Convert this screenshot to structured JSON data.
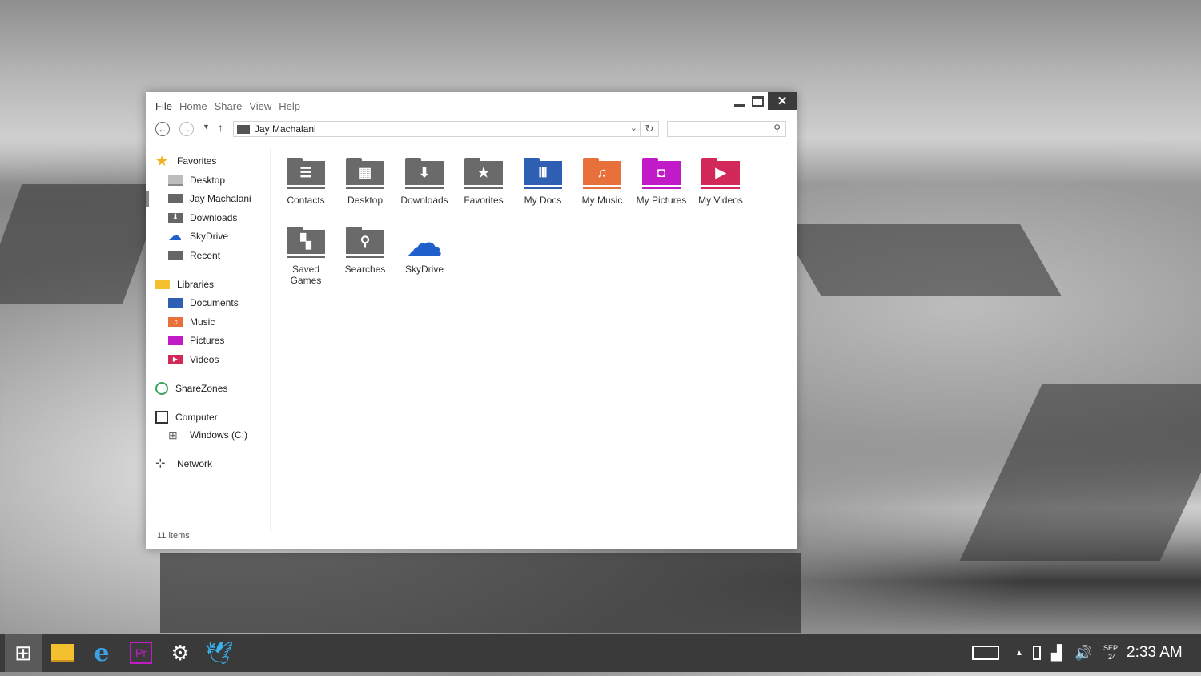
{
  "window": {
    "menu": [
      "File",
      "Home",
      "Share",
      "View",
      "Help"
    ],
    "close_label": "✕",
    "address": "Jay Machalani",
    "status": "11 items"
  },
  "sidebar": {
    "favorites": "Favorites",
    "fav_items": [
      "Desktop",
      "Jay Machalani",
      "Downloads",
      "SkyDrive",
      "Recent"
    ],
    "libraries": "Libraries",
    "lib_items": [
      "Documents",
      "Music",
      "Pictures",
      "Videos"
    ],
    "sharezones": "ShareZones",
    "computer": "Computer",
    "drive": "Windows (C:)",
    "network": "Network"
  },
  "folders": [
    {
      "label": "Contacts",
      "color": "#6a6a6a",
      "glyph": "☰"
    },
    {
      "label": "Desktop",
      "color": "#6a6a6a",
      "glyph": "▦"
    },
    {
      "label": "Downloads",
      "color": "#6a6a6a",
      "glyph": "⬇"
    },
    {
      "label": "Favorites",
      "color": "#6a6a6a",
      "glyph": "★"
    },
    {
      "label": "My Docs",
      "color": "#2f5fb3",
      "glyph": "Ⅲ"
    },
    {
      "label": "My Music",
      "color": "#e8703a",
      "glyph": "♫"
    },
    {
      "label": "My Pictures",
      "color": "#c11bc8",
      "glyph": "◘"
    },
    {
      "label": "My Videos",
      "color": "#d2285a",
      "glyph": "▶"
    },
    {
      "label": "Saved Games",
      "color": "#6a6a6a",
      "glyph": "▚"
    },
    {
      "label": "Searches",
      "color": "#6a6a6a",
      "glyph": "⚲"
    },
    {
      "label": "SkyDrive",
      "color": "#1f5fc9",
      "glyph": "☁"
    }
  ],
  "taskbar": {
    "apps": [
      "start",
      "file-explorer",
      "internet-explorer",
      "premiere",
      "steam",
      "twitter"
    ],
    "pr_label": "Pr",
    "date_month": "SEP",
    "date_day": "24",
    "time": "2:33 AM"
  }
}
